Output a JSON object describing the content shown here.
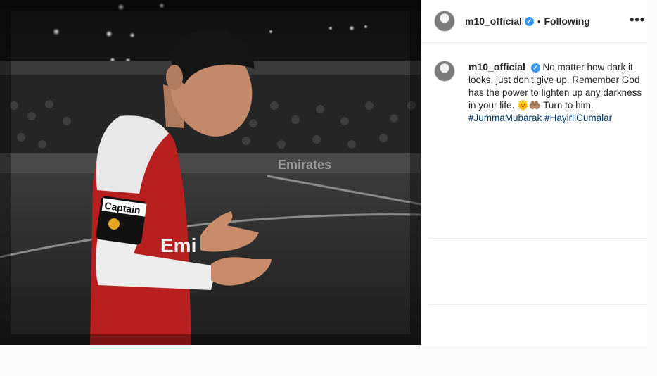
{
  "post": {
    "image_alt": "Player in red and white kit praying on a football pitch",
    "captain_band": "Captain",
    "shirt_sponsor": "Emi",
    "stadium_board": "Emirates"
  },
  "header": {
    "username": "m10_official",
    "verified_symbol": "✓",
    "separator": "•",
    "follow_status": "Following",
    "more_symbol": "•••"
  },
  "caption": {
    "username": "m10_official",
    "text": "No matter how dark it looks, just don't give up. Remember God has the power to lighten up any darkness in your life. 🌞🤲🏽 Turn to him.",
    "hashtags": [
      "#JummaMubarak",
      "#HayirliCumalar"
    ]
  }
}
